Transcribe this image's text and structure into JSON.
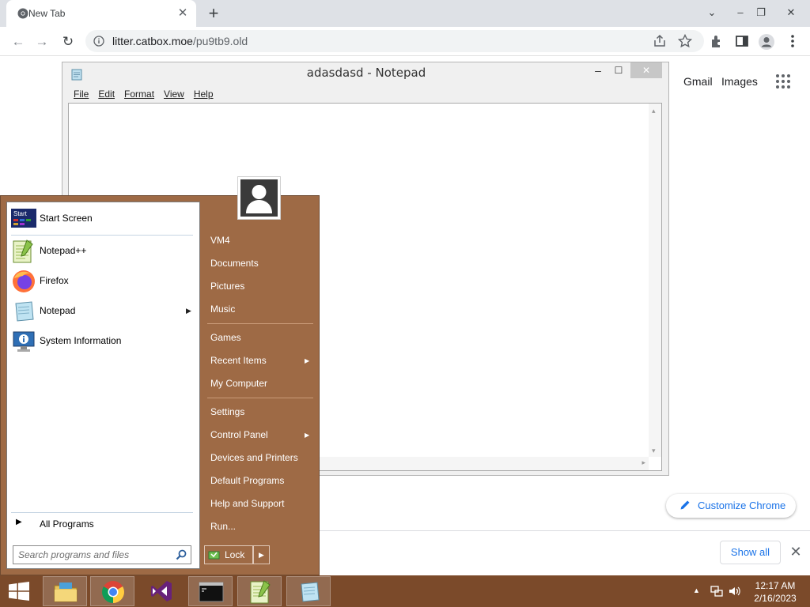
{
  "browser": {
    "tab_title": "New Tab",
    "tab_close": "✕",
    "new_tab": "+",
    "url_host": "litter.catbox.moe",
    "url_path": "/pu9tb9.old",
    "window_controls": [
      "⌄",
      "–",
      "❐",
      "✕"
    ]
  },
  "notepad": {
    "title": "adasdasd - Notepad",
    "menu": [
      "File",
      "Edit",
      "Format",
      "View",
      "Help"
    ],
    "controls": [
      "–",
      "☐",
      "✕"
    ]
  },
  "google": {
    "gmail": "Gmail",
    "images": "Images",
    "customize": "Customize Chrome",
    "show_all": "Show all",
    "close": "✕"
  },
  "start_menu": {
    "pinned": [
      {
        "label": "Start Screen",
        "icon": "start-screen-icon"
      },
      {
        "label": "Notepad++",
        "icon": "notepadpp-icon"
      },
      {
        "label": "Firefox",
        "icon": "firefox-icon"
      },
      {
        "label": "Notepad",
        "icon": "notepad-icon",
        "submenu": true
      },
      {
        "label": "System Information",
        "icon": "system-information-icon"
      }
    ],
    "all_programs": "All Programs",
    "search_placeholder": "Search programs and files",
    "right": {
      "group1": [
        "VM4",
        "Documents",
        "Pictures",
        "Music"
      ],
      "group2": [
        "Games",
        "Recent Items",
        "My Computer"
      ],
      "group3": [
        "Settings",
        "Control Panel",
        "Devices and Printers",
        "Default Programs",
        "Help and Support",
        "Run..."
      ]
    },
    "lock": "Lock",
    "start_tile_text": "Start"
  },
  "taskbar": {
    "apps": [
      "windows-start-icon",
      "file-explorer-icon",
      "chrome-icon",
      "visual-studio-icon",
      "command-prompt-icon",
      "notepadpp-icon",
      "notepad-icon"
    ],
    "time": "12:17 AM",
    "date": "2/16/2023"
  },
  "colors": {
    "start_menu_bg": "#9e6a45",
    "taskbar_bg": "#7b4a2a",
    "link_blue": "#1a73e8"
  }
}
